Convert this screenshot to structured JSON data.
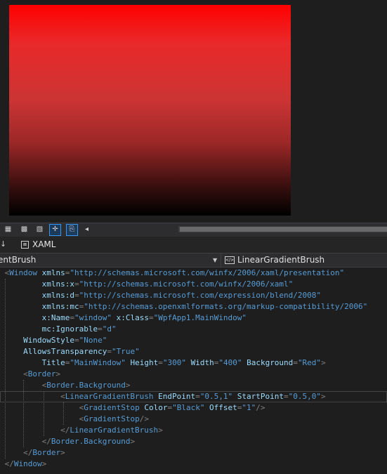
{
  "designer": {
    "preview_gradient": {
      "from": "#ff0000",
      "to": "#000000"
    }
  },
  "toolbar": {
    "buttons": [
      {
        "icon": "grid-icon",
        "glyph": "▦"
      },
      {
        "icon": "snap-grid-icon",
        "glyph": "▩"
      },
      {
        "icon": "checker-icon",
        "glyph": "▧"
      },
      {
        "icon": "snap-lines-icon",
        "glyph": "✛"
      },
      {
        "icon": "code-file-icon",
        "glyph": "⎘"
      },
      {
        "icon": "scroll-left-icon",
        "glyph": "◂"
      }
    ]
  },
  "tabs": {
    "left_glyph": "↓",
    "xaml_label": "XAML"
  },
  "navbar": {
    "left_text": "entBrush",
    "right_text": "LinearGradientBrush"
  },
  "code": {
    "colors": {
      "punct": "#808080",
      "element": "#569cd6",
      "attribute": "#9cdcfe",
      "value": "#569cd6"
    },
    "lines": [
      {
        "indent": "",
        "current": false,
        "tokens": [
          {
            "t": "p",
            "s": "<"
          },
          {
            "t": "e",
            "s": "Window"
          },
          {
            "t": "a",
            "s": " xmlns"
          },
          {
            "t": "p",
            "s": "="
          },
          {
            "t": "v",
            "s": "\"http://schemas.microsoft.com/winfx/2006/xaml/presentation\""
          }
        ]
      },
      {
        "indent": "        ",
        "current": false,
        "tokens": [
          {
            "t": "a",
            "s": "xmlns:x"
          },
          {
            "t": "p",
            "s": "="
          },
          {
            "t": "v",
            "s": "\"http://schemas.microsoft.com/winfx/2006/xaml\""
          }
        ]
      },
      {
        "indent": "        ",
        "current": false,
        "tokens": [
          {
            "t": "a",
            "s": "xmlns:d"
          },
          {
            "t": "p",
            "s": "="
          },
          {
            "t": "v",
            "s": "\"http://schemas.microsoft.com/expression/blend/2008\""
          }
        ]
      },
      {
        "indent": "        ",
        "current": false,
        "tokens": [
          {
            "t": "a",
            "s": "xmlns:mc"
          },
          {
            "t": "p",
            "s": "="
          },
          {
            "t": "v",
            "s": "\"http://schemas.openxmlformats.org/markup-compatibility/2006\""
          }
        ]
      },
      {
        "indent": "        ",
        "current": false,
        "tokens": [
          {
            "t": "a",
            "s": "x:Name"
          },
          {
            "t": "p",
            "s": "="
          },
          {
            "t": "v",
            "s": "\"window\""
          },
          {
            "t": "a",
            "s": " x:Class"
          },
          {
            "t": "p",
            "s": "="
          },
          {
            "t": "v",
            "s": "\"WpfApp1.MainWindow\""
          }
        ]
      },
      {
        "indent": "        ",
        "current": false,
        "tokens": [
          {
            "t": "a",
            "s": "mc:Ignorable"
          },
          {
            "t": "p",
            "s": "="
          },
          {
            "t": "v",
            "s": "\"d\""
          }
        ]
      },
      {
        "indent": "    ",
        "current": false,
        "tokens": [
          {
            "t": "a",
            "s": "WindowStyle"
          },
          {
            "t": "p",
            "s": "="
          },
          {
            "t": "v",
            "s": "\"None\""
          }
        ]
      },
      {
        "indent": "    ",
        "current": false,
        "tokens": [
          {
            "t": "a",
            "s": "AllowsTransparency"
          },
          {
            "t": "p",
            "s": "="
          },
          {
            "t": "v",
            "s": "\"True\""
          }
        ]
      },
      {
        "indent": "        ",
        "current": false,
        "tokens": [
          {
            "t": "a",
            "s": "Title"
          },
          {
            "t": "p",
            "s": "="
          },
          {
            "t": "v",
            "s": "\"MainWindow\""
          },
          {
            "t": "a",
            "s": " Height"
          },
          {
            "t": "p",
            "s": "="
          },
          {
            "t": "v",
            "s": "\"300\""
          },
          {
            "t": "a",
            "s": " Width"
          },
          {
            "t": "p",
            "s": "="
          },
          {
            "t": "v",
            "s": "\"400\""
          },
          {
            "t": "a",
            "s": " Background"
          },
          {
            "t": "p",
            "s": "="
          },
          {
            "t": "v",
            "s": "\"Red\""
          },
          {
            "t": "p",
            "s": ">"
          }
        ]
      },
      {
        "indent": "    ",
        "current": false,
        "tokens": [
          {
            "t": "p",
            "s": "<"
          },
          {
            "t": "e",
            "s": "Border"
          },
          {
            "t": "p",
            "s": ">"
          }
        ]
      },
      {
        "indent": "        ",
        "current": false,
        "tokens": [
          {
            "t": "p",
            "s": "<"
          },
          {
            "t": "e",
            "s": "Border.Background"
          },
          {
            "t": "p",
            "s": ">"
          }
        ]
      },
      {
        "indent": "            ",
        "current": true,
        "tokens": [
          {
            "t": "p",
            "s": "<"
          },
          {
            "t": "e",
            "s": "LinearGradientBrush"
          },
          {
            "t": "a",
            "s": " EndPoint"
          },
          {
            "t": "p",
            "s": "="
          },
          {
            "t": "v",
            "s": "\"0.5,1\""
          },
          {
            "t": "a",
            "s": " StartPoint"
          },
          {
            "t": "p",
            "s": "="
          },
          {
            "t": "v",
            "s": "\"0.5,0\""
          },
          {
            "t": "p",
            "s": ">"
          }
        ]
      },
      {
        "indent": "                ",
        "current": false,
        "tokens": [
          {
            "t": "p",
            "s": "<"
          },
          {
            "t": "e",
            "s": "GradientStop"
          },
          {
            "t": "a",
            "s": " Color"
          },
          {
            "t": "p",
            "s": "="
          },
          {
            "t": "v",
            "s": "\"Black\""
          },
          {
            "t": "a",
            "s": " Offset"
          },
          {
            "t": "p",
            "s": "="
          },
          {
            "t": "v",
            "s": "\"1\""
          },
          {
            "t": "p",
            "s": "/>"
          }
        ]
      },
      {
        "indent": "                ",
        "current": false,
        "tokens": [
          {
            "t": "p",
            "s": "<"
          },
          {
            "t": "e",
            "s": "GradientStop"
          },
          {
            "t": "p",
            "s": "/>"
          }
        ]
      },
      {
        "indent": "            ",
        "current": false,
        "tokens": [
          {
            "t": "p",
            "s": "</"
          },
          {
            "t": "e",
            "s": "LinearGradientBrush"
          },
          {
            "t": "p",
            "s": ">"
          }
        ]
      },
      {
        "indent": "        ",
        "current": false,
        "tokens": [
          {
            "t": "p",
            "s": "</"
          },
          {
            "t": "e",
            "s": "Border.Background"
          },
          {
            "t": "p",
            "s": ">"
          }
        ]
      },
      {
        "indent": "    ",
        "current": false,
        "tokens": [
          {
            "t": "p",
            "s": "</"
          },
          {
            "t": "e",
            "s": "Border"
          },
          {
            "t": "p",
            "s": ">"
          }
        ]
      },
      {
        "indent": "",
        "current": false,
        "tokens": [
          {
            "t": "p",
            "s": "</"
          },
          {
            "t": "e",
            "s": "Window"
          },
          {
            "t": "p",
            "s": ">"
          }
        ]
      }
    ]
  }
}
